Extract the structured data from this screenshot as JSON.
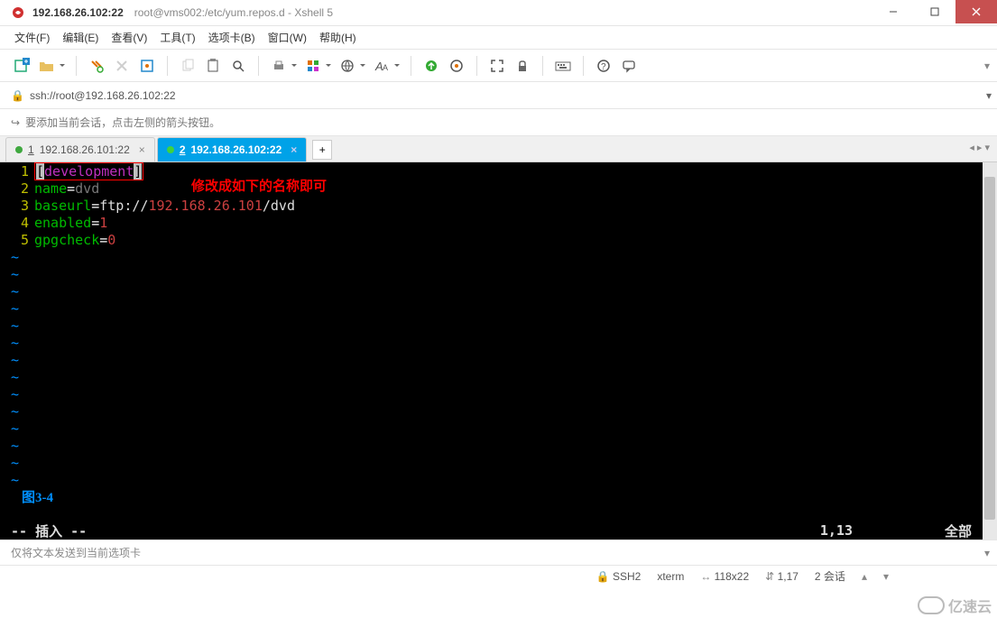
{
  "window": {
    "host_title": "192.168.26.102:22",
    "path_title": "root@vms002:/etc/yum.repos.d - Xshell 5"
  },
  "menu": {
    "file": "文件(F)",
    "edit": "编辑(E)",
    "view": "查看(V)",
    "tools": "工具(T)",
    "tabs": "选项卡(B)",
    "window": "窗口(W)",
    "help": "帮助(H)"
  },
  "address": {
    "url": "ssh://root@192.168.26.102:22"
  },
  "tip": "要添加当前会话，点击左侧的箭头按钮。",
  "tabs": {
    "t1_num": "1",
    "t1_label": "192.168.26.101:22",
    "t2_num": "2",
    "t2_label": "192.168.26.102:22"
  },
  "editor": {
    "l1_a": "[",
    "l1_b": "development",
    "l1_c": "]",
    "annotation": "修改成如下的名称即可",
    "l2_a": "name",
    "l2_b": "=",
    "l2_c": "dvd",
    "l3_a": "baseurl",
    "l3_b": "=",
    "l3_c": "ftp://",
    "l3_d": "192.168.26.101",
    "l3_e": "/dvd",
    "l4_a": "enabled",
    "l4_b": "=",
    "l4_c": "1",
    "l5_a": "gpgcheck",
    "l5_b": "=",
    "l5_c": "0",
    "fig": "图3-4",
    "mode": "-- 插入 --",
    "pos": "1,13",
    "scope": "全部",
    "ln1": "1",
    "ln2": "2",
    "ln3": "3",
    "ln4": "4",
    "ln5": "5"
  },
  "sendbar": "仅将文本发送到当前选项卡",
  "status": {
    "ssh": "SSH2",
    "term": "xterm",
    "size": "118x22",
    "rc": "1,17",
    "sess": "2 会话"
  },
  "watermark": "亿速云"
}
